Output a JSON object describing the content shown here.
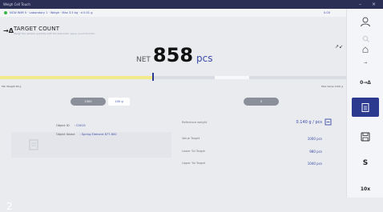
{
  "window": {
    "title": "Weigh Cell Touch",
    "controls": [
      "–",
      "×"
    ]
  },
  "statusbar": {
    "crumbs": "NCW WIM 5 · Laboratory 1 · Weigh · Max 3.5 kg · d 0.01 g",
    "right": "0.00"
  },
  "mode": {
    "icon": "→Δ",
    "title": "TARGET COUNT",
    "subtitle": "Weigh the sample quantity with the automatic piece count function"
  },
  "weight": {
    "net_label": "NET",
    "value": "858",
    "unit": "pcs"
  },
  "progress": {
    "fill_fraction": 0.44,
    "marker_fraction": 0.44,
    "tol_start": 0.62,
    "tol_end": 0.72
  },
  "limits": {
    "min": "Min Weight 80 g",
    "max": "Max Value 1100 g"
  },
  "controls": {
    "left_label": "1000",
    "left_tag": "100 g",
    "right_label": "0"
  },
  "article": {
    "id_label": "Object ID",
    "id_value": ": C0015",
    "name_label": "Object Name",
    "name_value": ": Spring Element 877-600"
  },
  "target": {
    "rows": [
      {
        "label": "Reference weight",
        "value": "0.140 g / pcs"
      },
      {
        "label": "Value Target",
        "value": "1000 pcs"
      },
      {
        "label": "Lower Tol Target",
        "value": "980 pcs"
      },
      {
        "label": "Upper Tol Target",
        "value": "1040 pcs"
      }
    ]
  },
  "sidebar": {
    "items": [
      {
        "icon": "user-icon",
        "label": ""
      },
      {
        "icon": "search-icon",
        "label": ""
      },
      {
        "icon": "home-icon",
        "label": ""
      },
      {
        "icon": "arrows-icon",
        "label": "→"
      },
      {
        "icon": "zero-tare-icon",
        "label": "0→Δ"
      },
      {
        "icon": "clipboard-icon",
        "label": ""
      },
      {
        "icon": "save-icon",
        "label": ""
      },
      {
        "icon": "sum-icon",
        "label": "S"
      },
      {
        "icon": "factor-icon",
        "label": "10x"
      }
    ]
  },
  "screen_number": "2",
  "colors": {
    "titlebar": "#2b2f55",
    "accent": "#3a4ba8",
    "selected": "#2b3a8f"
  }
}
